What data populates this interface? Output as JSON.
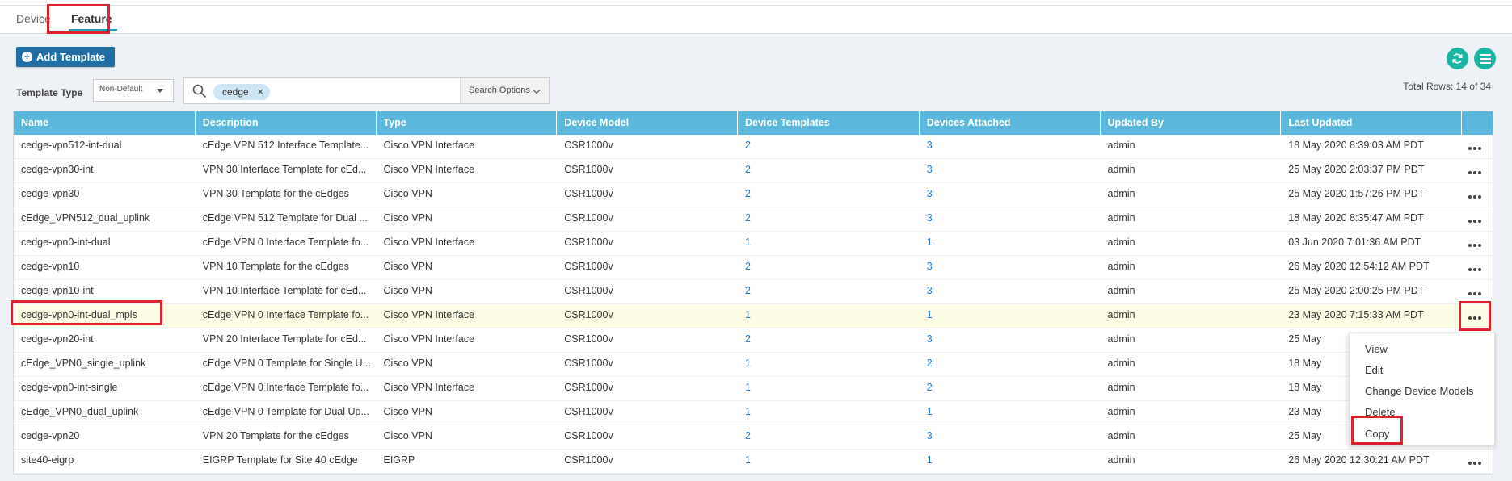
{
  "tabs": {
    "device": "Device",
    "feature": "Feature"
  },
  "toolbar": {
    "add_template": "Add Template",
    "template_type_label": "Template Type",
    "template_type_value": "Non-Default",
    "search_chip": "cedge",
    "search_options": "Search Options",
    "total_rows": "Total Rows: 14 of 34"
  },
  "table": {
    "headers": [
      "Name",
      "Description",
      "Type",
      "Device Model",
      "Device Templates",
      "Devices Attached",
      "Updated By",
      "Last Updated"
    ],
    "rows": [
      [
        "cedge-vpn512-int-dual",
        "cEdge VPN 512 Interface Template...",
        "Cisco VPN Interface",
        "CSR1000v",
        "2",
        "3",
        "admin",
        "18 May 2020 8:39:03 AM PDT"
      ],
      [
        "cedge-vpn30-int",
        "VPN 30 Interface Template for cEd...",
        "Cisco VPN Interface",
        "CSR1000v",
        "2",
        "3",
        "admin",
        "25 May 2020 2:03:37 PM PDT"
      ],
      [
        "cedge-vpn30",
        "VPN 30 Template for the cEdges",
        "Cisco VPN",
        "CSR1000v",
        "2",
        "3",
        "admin",
        "25 May 2020 1:57:26 PM PDT"
      ],
      [
        "cEdge_VPN512_dual_uplink",
        "cEdge VPN 512 Template for Dual ...",
        "Cisco VPN",
        "CSR1000v",
        "2",
        "3",
        "admin",
        "18 May 2020 8:35:47 AM PDT"
      ],
      [
        "cedge-vpn0-int-dual",
        "cEdge VPN 0 Interface Template fo...",
        "Cisco VPN Interface",
        "CSR1000v",
        "1",
        "1",
        "admin",
        "03 Jun 2020 7:01:36 AM PDT"
      ],
      [
        "cedge-vpn10",
        "VPN 10 Template for the cEdges",
        "Cisco VPN",
        "CSR1000v",
        "2",
        "3",
        "admin",
        "26 May 2020 12:54:12 AM PDT"
      ],
      [
        "cedge-vpn10-int",
        "VPN 10 Interface Template for cEd...",
        "Cisco VPN",
        "CSR1000v",
        "2",
        "3",
        "admin",
        "25 May 2020 2:00:25 PM PDT"
      ],
      [
        "cedge-vpn0-int-dual_mpls",
        "cEdge VPN 0 Interface Template fo...",
        "Cisco VPN Interface",
        "CSR1000v",
        "1",
        "1",
        "admin",
        "23 May 2020 7:15:33 AM PDT"
      ],
      [
        "cedge-vpn20-int",
        "VPN 20 Interface Template for cEd...",
        "Cisco VPN Interface",
        "CSR1000v",
        "2",
        "3",
        "admin",
        "25 May"
      ],
      [
        "cEdge_VPN0_single_uplink",
        "cEdge VPN 0 Template for Single U...",
        "Cisco VPN",
        "CSR1000v",
        "1",
        "2",
        "admin",
        "18 May"
      ],
      [
        "cedge-vpn0-int-single",
        "cEdge VPN 0 Interface Template fo...",
        "Cisco VPN Interface",
        "CSR1000v",
        "1",
        "2",
        "admin",
        "18 May"
      ],
      [
        "cEdge_VPN0_dual_uplink",
        "cEdge VPN 0 Template for Dual Up...",
        "Cisco VPN",
        "CSR1000v",
        "1",
        "1",
        "admin",
        "23 May"
      ],
      [
        "cedge-vpn20",
        "VPN 20 Template for the cEdges",
        "Cisco VPN",
        "CSR1000v",
        "2",
        "3",
        "admin",
        "25 May"
      ],
      [
        "site40-eigrp",
        "EIGRP Template for Site 40 cEdge",
        "EIGRP",
        "CSR1000v",
        "1",
        "1",
        "admin",
        "26 May 2020 12:30:21 AM PDT"
      ]
    ]
  },
  "context_menu": {
    "items": [
      "View",
      "Edit",
      "Change Device Models",
      "Delete",
      "Copy"
    ]
  },
  "colors": {
    "header": "#5bb8dc",
    "accent": "#1bb5a6",
    "button": "#1f6fa5",
    "highlight": "#e0212b"
  }
}
